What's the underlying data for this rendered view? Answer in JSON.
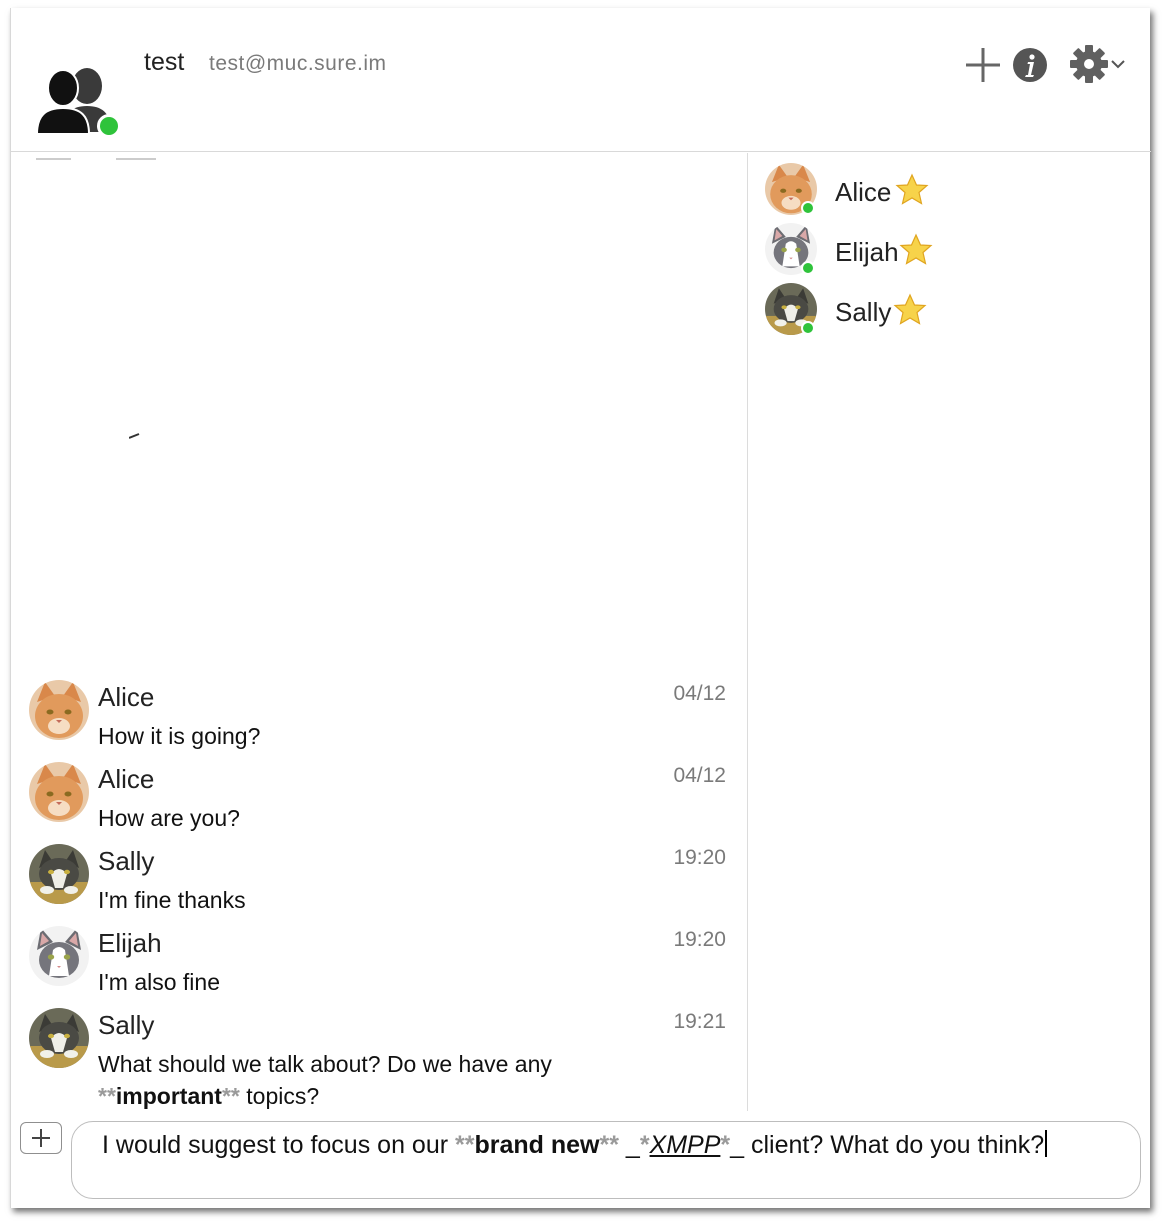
{
  "header": {
    "title": "test",
    "jid": "test@muc.sure.im"
  },
  "occupants": [
    {
      "name": "Alice",
      "status": "online"
    },
    {
      "name": "Elijah",
      "status": "online"
    },
    {
      "name": "Sally",
      "status": "online"
    }
  ],
  "messages": [
    {
      "sender": "Alice",
      "time": "04/12",
      "text": "How it is going?"
    },
    {
      "sender": "Alice",
      "time": "04/12",
      "text": "How are you?"
    },
    {
      "sender": "Sally",
      "time": "19:20",
      "text": "I'm fine thanks"
    },
    {
      "sender": "Elijah",
      "time": "19:20",
      "text": "I'm also fine"
    },
    {
      "sender": "Sally",
      "time": "19:21",
      "line1": "What should we talk about? Do we have any",
      "md_open": "**",
      "bold": "important",
      "md_close": "**",
      "tail": " topics?"
    }
  ],
  "composer": {
    "p1": "I would suggest to focus on our ",
    "md1": "**",
    "bold": "brand new",
    "md2": "**",
    "p2": " _",
    "md3": "*",
    "italic": "XMPP",
    "md4": "*",
    "p3": "_ client? What do you think?"
  },
  "colors": {
    "presence_online": "#2fc33b",
    "markdown_marker": "#9a9a9a",
    "secondary_text": "#7a7a7a"
  },
  "icons": [
    "group-avatar-icon",
    "add-icon",
    "info-icon",
    "gear-icon",
    "chevron-down-icon",
    "star-icon",
    "attach-plus-icon"
  ]
}
